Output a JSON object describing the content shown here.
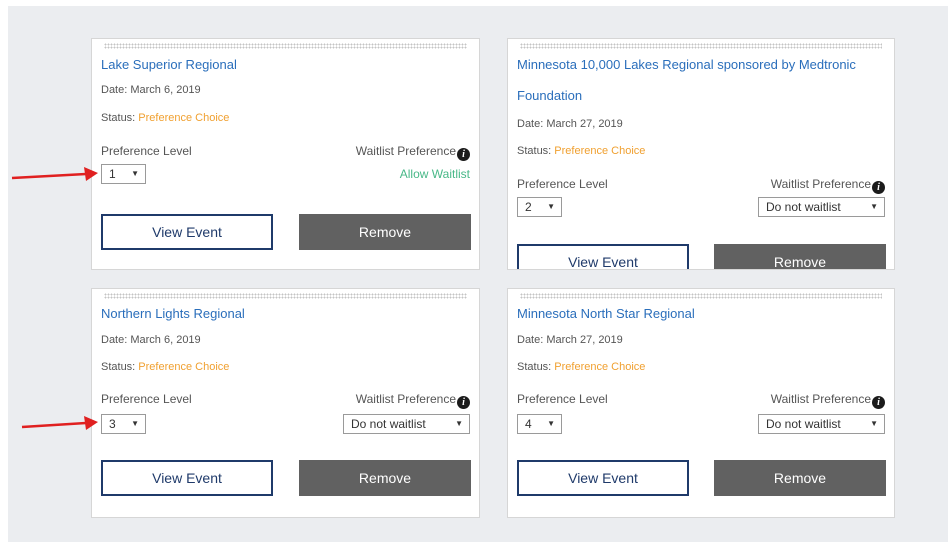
{
  "cards": [
    {
      "title": "Lake Superior Regional",
      "date": "Date: March 6, 2019",
      "status_label": "Status: ",
      "status_value": "Preference Choice",
      "preference_label": "Preference Level",
      "preference_value": "1",
      "waitlist_label": "Waitlist Preference",
      "waitlist_value": "Allow Waitlist",
      "view_label": "View Event",
      "remove_label": "Remove"
    },
    {
      "title": "Minnesota 10,000 Lakes Regional sponsored by Medtronic Foundation",
      "date": "Date: March 27, 2019",
      "status_label": "Status: ",
      "status_value": "Preference Choice",
      "preference_label": "Preference Level",
      "preference_value": "2",
      "waitlist_label": "Waitlist Preference",
      "waitlist_value": "Do not waitlist",
      "view_label": "View Event",
      "remove_label": "Remove"
    },
    {
      "title": "Northern Lights Regional",
      "date": "Date: March 6, 2019",
      "status_label": "Status: ",
      "status_value": "Preference Choice",
      "preference_label": "Preference Level",
      "preference_value": "3",
      "waitlist_label": "Waitlist Preference",
      "waitlist_value": "Do not waitlist",
      "view_label": "View Event",
      "remove_label": "Remove"
    },
    {
      "title": "Minnesota North Star Regional",
      "date": "Date: March 27, 2019",
      "status_label": "Status: ",
      "status_value": "Preference Choice",
      "preference_label": "Preference Level",
      "preference_value": "4",
      "waitlist_label": "Waitlist Preference",
      "waitlist_value": "Do not waitlist",
      "view_label": "View Event",
      "remove_label": "Remove"
    }
  ],
  "icons": {
    "info": "info-icon",
    "dropdown": "caret-down-icon",
    "annotation": "red-arrow"
  },
  "colors": {
    "link": "#2a6ebb",
    "status": "#f0a030",
    "allow_waitlist": "#47b887",
    "remove_button": "#616161",
    "view_border": "#1f3a6a",
    "arrow": "#e02020",
    "background": "#ebedf0"
  }
}
